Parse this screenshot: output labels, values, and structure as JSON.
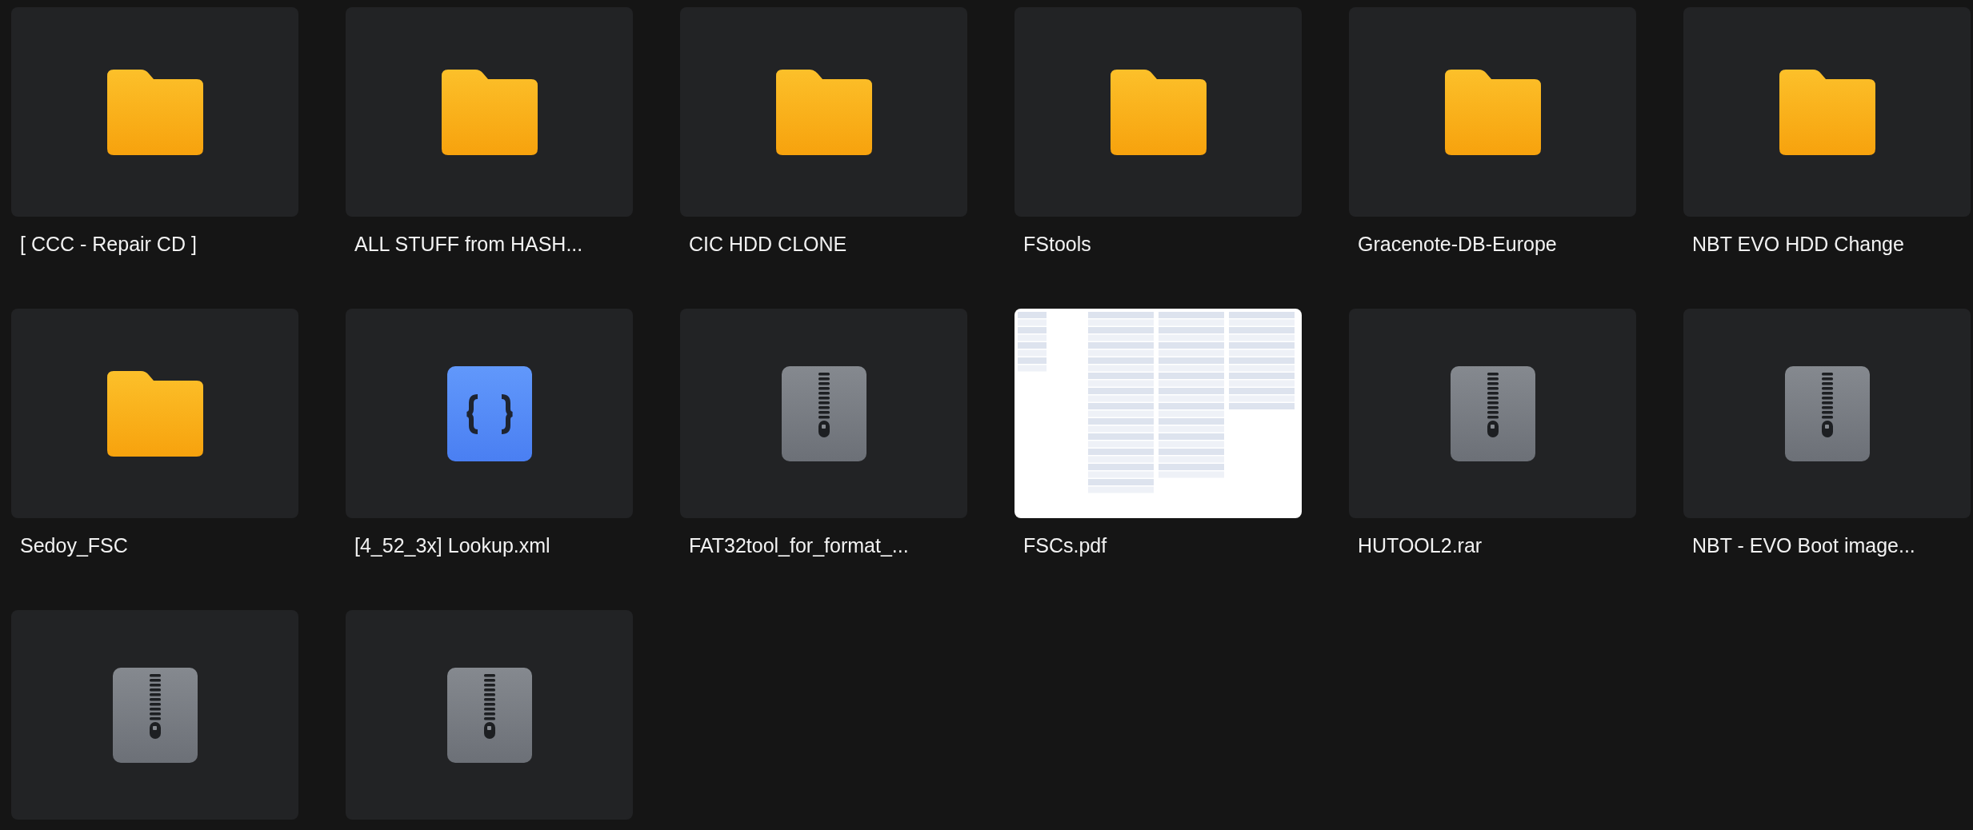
{
  "files": [
    {
      "kind": "folder",
      "name": "[ CCC - Repair CD ]"
    },
    {
      "kind": "folder",
      "name": "ALL STUFF from HASH..."
    },
    {
      "kind": "folder",
      "name": "CIC HDD CLONE"
    },
    {
      "kind": "folder",
      "name": "FStools"
    },
    {
      "kind": "folder",
      "name": "Gracenote-DB-Europe"
    },
    {
      "kind": "folder",
      "name": "NBT EVO HDD Change"
    },
    {
      "kind": "folder",
      "name": "Sedoy_FSC"
    },
    {
      "kind": "code",
      "name": "[4_52_3x] Lookup.xml"
    },
    {
      "kind": "archive",
      "name": "FAT32tool_for_format_..."
    },
    {
      "kind": "document",
      "name": "FSCs.pdf"
    },
    {
      "kind": "archive",
      "name": "HUTOOL2.rar"
    },
    {
      "kind": "archive",
      "name": "NBT - EVO Boot image..."
    },
    {
      "kind": "archive"
    },
    {
      "kind": "archive"
    }
  ]
}
